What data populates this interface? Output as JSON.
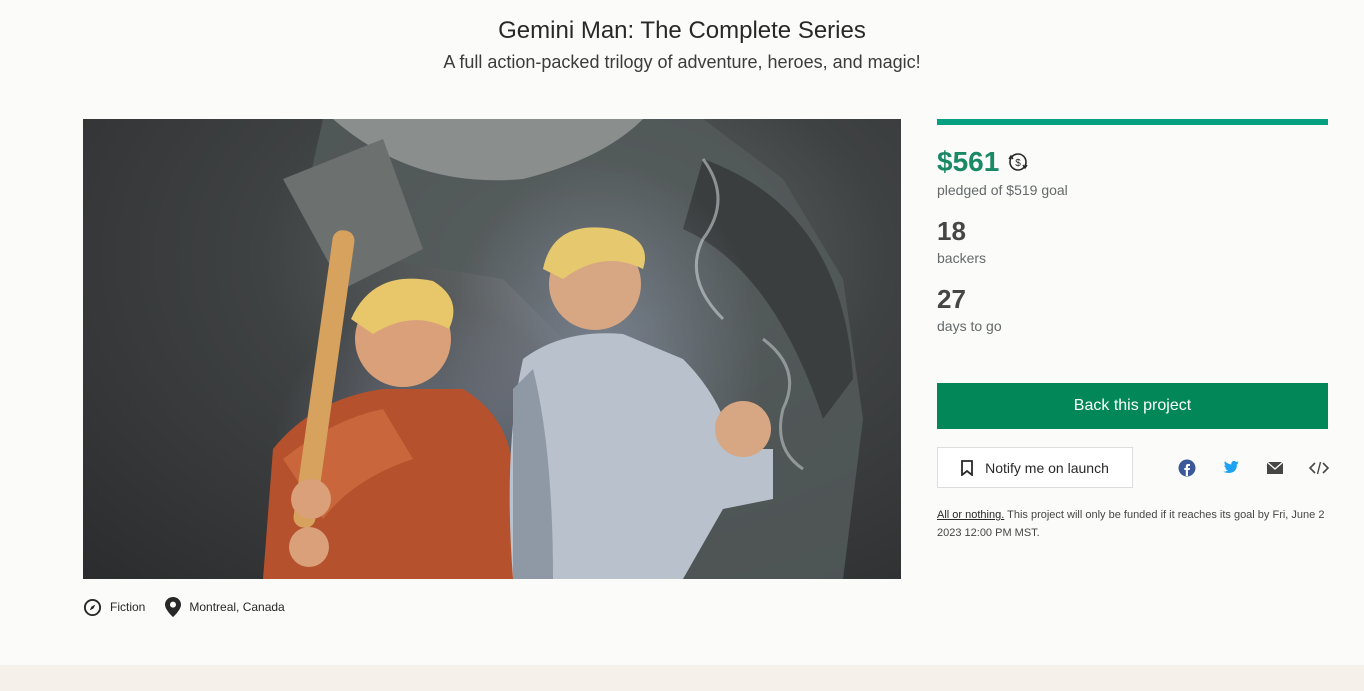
{
  "project": {
    "title": "Gemini Man: The Complete Series",
    "subtitle": "A full action-packed trilogy of adventure, heroes, and magic!"
  },
  "meta": {
    "category": "Fiction",
    "location": "Montreal, Canada"
  },
  "stats": {
    "pledged": "$561",
    "pledged_label": "pledged of $519 goal",
    "progress_fraction": 1.0,
    "backers": "18",
    "backers_label": "backers",
    "days": "27",
    "days_label": "days to go"
  },
  "actions": {
    "back_label": "Back this project",
    "notify_label": "Notify me on launch",
    "share_icons": [
      "facebook-icon",
      "twitter-icon",
      "email-icon",
      "embed-icon"
    ]
  },
  "funding_note": {
    "link": "All or nothing.",
    "text": " This project will only be funded if it reaches its goal by Fri, June 2 2023 12:00 PM MST."
  },
  "colors": {
    "accent": "#028858",
    "pledged": "#1a8a66",
    "progress": "#05a081"
  }
}
